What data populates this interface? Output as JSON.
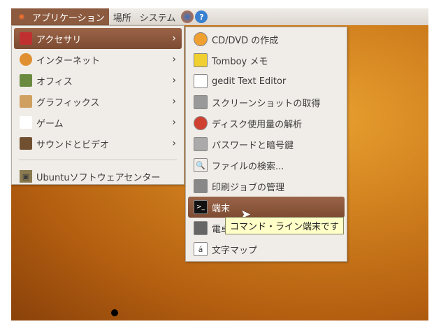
{
  "panel": {
    "applications": "アプリケーション",
    "places": "場所",
    "system": "システム"
  },
  "menu": [
    {
      "label": "アクセサリ",
      "icon": "accessories-icon",
      "selected": true
    },
    {
      "label": "インターネット",
      "icon": "globe-icon"
    },
    {
      "label": "オフィス",
      "icon": "office-icon"
    },
    {
      "label": "グラフィックス",
      "icon": "graphics-icon"
    },
    {
      "label": "ゲーム",
      "icon": "cards-icon"
    },
    {
      "label": "サウンドとビデオ",
      "icon": "multimedia-icon"
    }
  ],
  "software_center": "Ubuntuソフトウェアセンター",
  "submenu": [
    {
      "label": "CD/DVD の作成"
    },
    {
      "label": "Tomboy メモ"
    },
    {
      "label": "gedit Text Editor"
    },
    {
      "label": "スクリーンショットの取得"
    },
    {
      "label": "ディスク使用量の解析"
    },
    {
      "label": "パスワードと暗号鍵"
    },
    {
      "label": "ファイルの検索..."
    },
    {
      "label": "印刷ジョブの管理"
    },
    {
      "label": "端末"
    },
    {
      "label": "電卓"
    },
    {
      "label": "文字マップ"
    }
  ],
  "tooltip": "コマンド・ライン端末です",
  "arrow": "›",
  "charmap_glyph": "á"
}
